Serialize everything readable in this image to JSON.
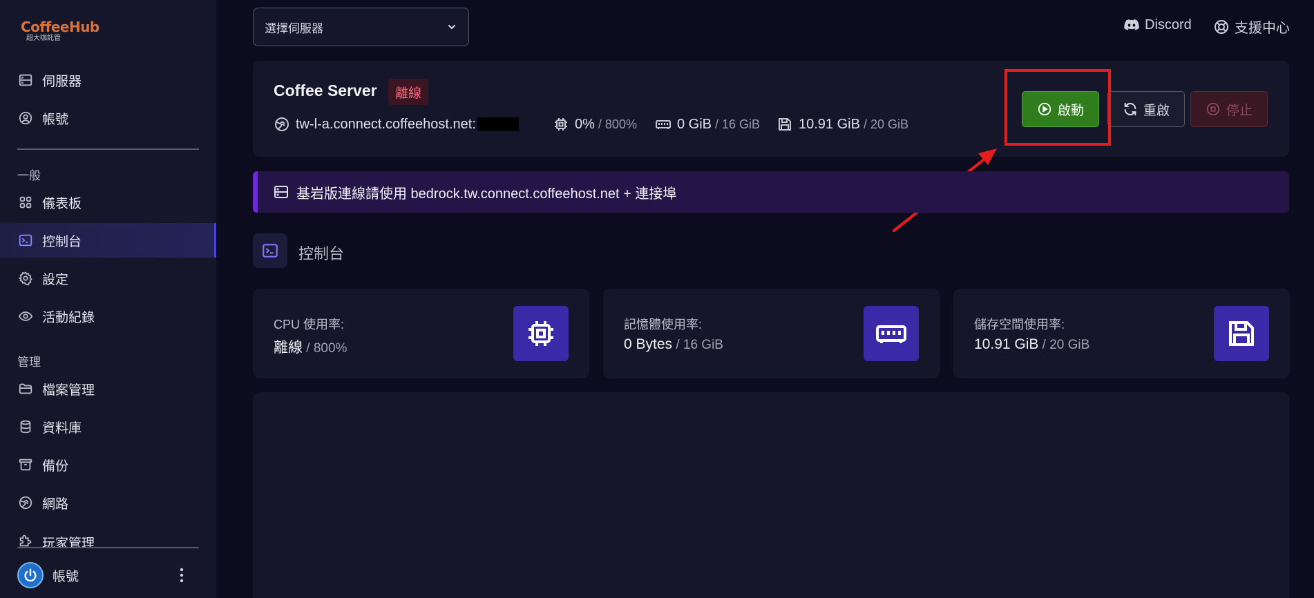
{
  "brand": {
    "name": "CoffeeHub",
    "tagline": "超大咖託管",
    "color": "#d9743c"
  },
  "sidebar": {
    "top_items": [
      {
        "label": "伺服器",
        "icon": "server-icon"
      },
      {
        "label": "帳號",
        "icon": "user-circle-icon"
      }
    ],
    "sections": [
      {
        "label": "一般",
        "items": [
          {
            "label": "儀表板",
            "icon": "grid-icon"
          },
          {
            "label": "控制台",
            "icon": "terminal-icon",
            "active": true
          },
          {
            "label": "設定",
            "icon": "gear-icon"
          },
          {
            "label": "活動紀錄",
            "icon": "eye-icon"
          }
        ]
      },
      {
        "label": "管理",
        "items": [
          {
            "label": "檔案管理",
            "icon": "folder-icon"
          },
          {
            "label": "資料庫",
            "icon": "database-icon"
          },
          {
            "label": "備份",
            "icon": "archive-icon"
          },
          {
            "label": "網路",
            "icon": "globe-icon"
          },
          {
            "label": "玩家管理",
            "icon": "puzzle-icon"
          }
        ]
      }
    ],
    "account": {
      "label": "帳號"
    }
  },
  "topbar": {
    "server_select": {
      "placeholder": "選擇伺服器"
    },
    "links": [
      {
        "label": "Discord",
        "icon": "discord-icon"
      },
      {
        "label": "支援中心",
        "icon": "lifebuoy-icon"
      }
    ]
  },
  "server": {
    "name": "Coffee Server",
    "status": "離線",
    "address": "tw-l-a.connect.coffeehost.net:",
    "cpu": {
      "value": "0%",
      "limit": "/ 800%"
    },
    "memory": {
      "value": "0 GiB",
      "limit": "/ 16 GiB"
    },
    "disk": {
      "value": "10.91 GiB",
      "limit": "/ 20 GiB"
    },
    "actions": {
      "start": "啟動",
      "restart": "重啟",
      "stop": "停止"
    }
  },
  "banner": {
    "text": "基岩版連線請使用 bedrock.tw.connect.coffeehost.net + 連接埠"
  },
  "console": {
    "title": "控制台"
  },
  "metrics": [
    {
      "label": "CPU 使用率:",
      "value": "離線",
      "limit": " / 800%",
      "icon": "cpu-icon"
    },
    {
      "label": "記憶體使用率:",
      "value": "0 Bytes",
      "limit": " / 16 GiB",
      "icon": "memory-icon"
    },
    {
      "label": "儲存空間使用率:",
      "value": "10.91 GiB",
      "limit": " / 20 GiB",
      "icon": "floppy-disk-icon"
    }
  ],
  "colors": {
    "background": "#0c0c1e",
    "panel": "#16162a",
    "accent": "#3a2aa8",
    "start_green": "#2f7d1d",
    "offline_red": "#ff6a80",
    "highlight_red": "#e51d1d"
  }
}
